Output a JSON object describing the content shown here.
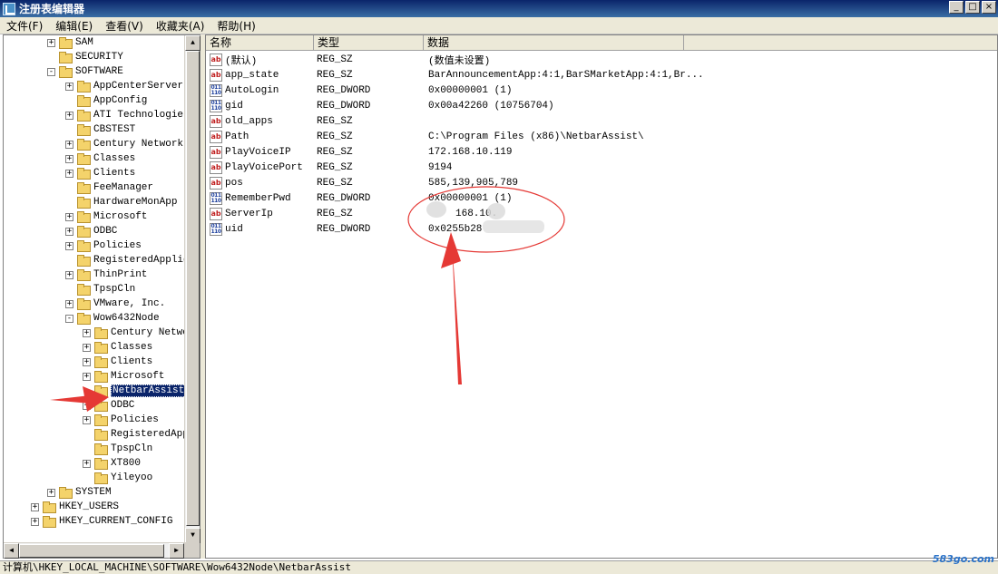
{
  "window": {
    "title": "注册表编辑器",
    "controls": [
      "_",
      "□",
      "×"
    ]
  },
  "menu": [
    "文件(F)",
    "编辑(E)",
    "查看(V)",
    "收藏夹(A)",
    "帮助(H)"
  ],
  "tree": [
    {
      "label": "SAM",
      "level": 2,
      "expander": "+"
    },
    {
      "label": "SECURITY",
      "level": 2,
      "expander": ""
    },
    {
      "label": "SOFTWARE",
      "level": 2,
      "expander": "-"
    },
    {
      "label": "AppCenterServer",
      "level": 3,
      "expander": "+"
    },
    {
      "label": "AppConfig",
      "level": 3,
      "expander": ""
    },
    {
      "label": "ATI Technologies",
      "level": 3,
      "expander": "+"
    },
    {
      "label": "CBSTEST",
      "level": 3,
      "expander": ""
    },
    {
      "label": "Century Network",
      "level": 3,
      "expander": "+"
    },
    {
      "label": "Classes",
      "level": 3,
      "expander": "+"
    },
    {
      "label": "Clients",
      "level": 3,
      "expander": "+"
    },
    {
      "label": "FeeManager",
      "level": 3,
      "expander": ""
    },
    {
      "label": "HardwareMonApp",
      "level": 3,
      "expander": ""
    },
    {
      "label": "Microsoft",
      "level": 3,
      "expander": "+"
    },
    {
      "label": "ODBC",
      "level": 3,
      "expander": "+"
    },
    {
      "label": "Policies",
      "level": 3,
      "expander": "+"
    },
    {
      "label": "RegisteredApplic",
      "level": 3,
      "expander": ""
    },
    {
      "label": "ThinPrint",
      "level": 3,
      "expander": "+"
    },
    {
      "label": "TpspCln",
      "level": 3,
      "expander": ""
    },
    {
      "label": "VMware, Inc.",
      "level": 3,
      "expander": "+"
    },
    {
      "label": "Wow6432Node",
      "level": 3,
      "expander": "-"
    },
    {
      "label": "Century Netwo",
      "level": 4,
      "expander": "+"
    },
    {
      "label": "Classes",
      "level": 4,
      "expander": "+"
    },
    {
      "label": "Clients",
      "level": 4,
      "expander": "+"
    },
    {
      "label": "Microsoft",
      "level": 4,
      "expander": "+"
    },
    {
      "label": "NetbarAssist",
      "level": 4,
      "expander": "",
      "selected": true
    },
    {
      "label": "ODBC",
      "level": 4,
      "expander": "+"
    },
    {
      "label": "Policies",
      "level": 4,
      "expander": "+"
    },
    {
      "label": "RegisteredApp",
      "level": 4,
      "expander": ""
    },
    {
      "label": "TpspCln",
      "level": 4,
      "expander": ""
    },
    {
      "label": "XT800",
      "level": 4,
      "expander": "+"
    },
    {
      "label": "Yileyoo",
      "level": 4,
      "expander": ""
    },
    {
      "label": "SYSTEM",
      "level": 2,
      "expander": "+"
    },
    {
      "label": "HKEY_USERS",
      "level": 1,
      "expander": "+"
    },
    {
      "label": "HKEY_CURRENT_CONFIG",
      "level": 1,
      "expander": "+"
    }
  ],
  "columns": {
    "name": "名称",
    "type": "类型",
    "data": "数据"
  },
  "values": [
    {
      "icon": "ab",
      "name": "(默认)",
      "type": "REG_SZ",
      "data": "(数值未设置)"
    },
    {
      "icon": "ab",
      "name": "app_state",
      "type": "REG_SZ",
      "data": "BarAnnouncementApp:4:1,BarSMarketApp:4:1,Br..."
    },
    {
      "icon": "dw",
      "name": "AutoLogin",
      "type": "REG_DWORD",
      "data": "0x00000001 (1)"
    },
    {
      "icon": "dw",
      "name": "gid",
      "type": "REG_DWORD",
      "data": "0x00a42260 (10756704)"
    },
    {
      "icon": "ab",
      "name": "old_apps",
      "type": "REG_SZ",
      "data": ""
    },
    {
      "icon": "ab",
      "name": "Path",
      "type": "REG_SZ",
      "data": "C:\\Program Files (x86)\\NetbarAssist\\"
    },
    {
      "icon": "ab",
      "name": "PlayVoiceIP",
      "type": "REG_SZ",
      "data": "172.168.10.119"
    },
    {
      "icon": "ab",
      "name": "PlayVoicePort",
      "type": "REG_SZ",
      "data": "9194"
    },
    {
      "icon": "ab",
      "name": "pos",
      "type": "REG_SZ",
      "data": "585,139,905,789"
    },
    {
      "icon": "dw",
      "name": "RememberPwd",
      "type": "REG_DWORD",
      "data": "0x00000001 (1)"
    },
    {
      "icon": "ab",
      "name": "ServerIp",
      "type": "REG_SZ",
      "data": "168.10."
    },
    {
      "icon": "dw",
      "name": "uid",
      "type": "REG_DWORD",
      "data": "0x0255b28"
    }
  ],
  "status": "计算机\\HKEY_LOCAL_MACHINE\\SOFTWARE\\Wow6432Node\\NetbarAssist",
  "watermark": "583go.com",
  "colors": {
    "annotation": "#e53935",
    "selection": "#0a246a",
    "folder": "#f4d36b"
  }
}
